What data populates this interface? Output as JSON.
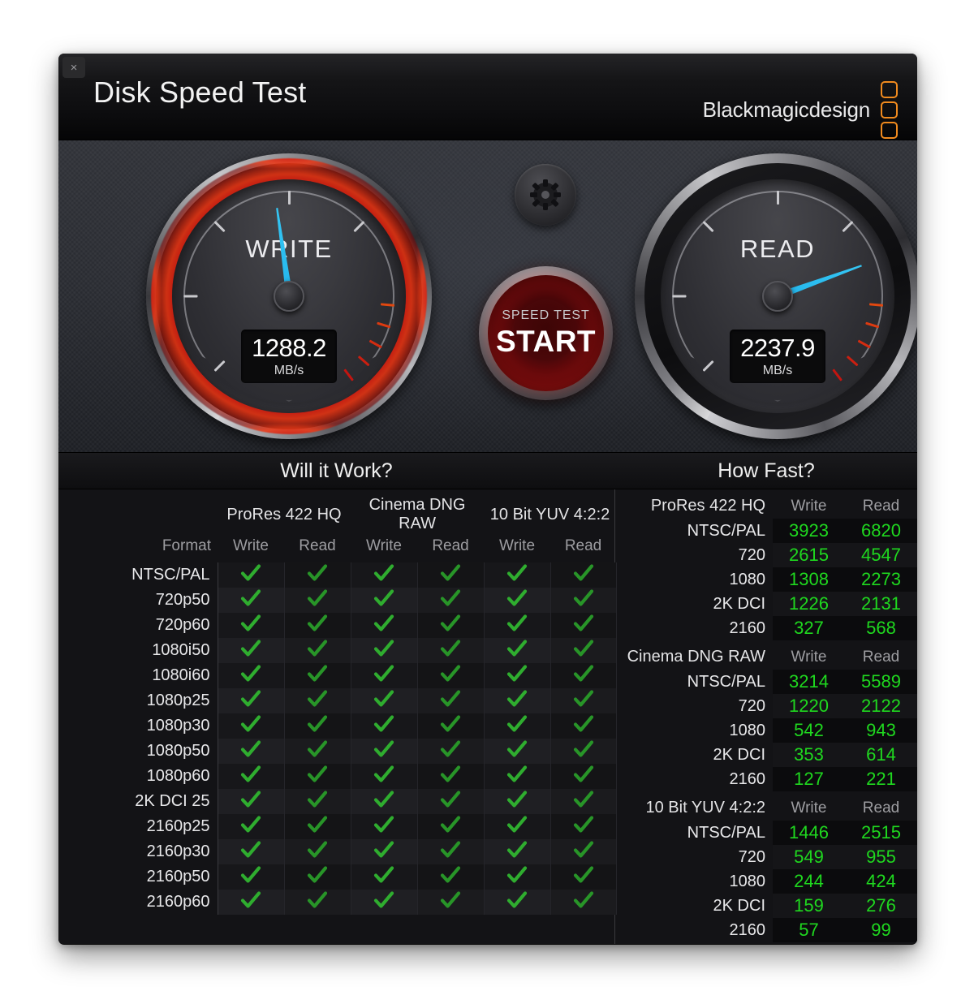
{
  "window": {
    "title": "Disk Speed Test",
    "close_label": "×",
    "brand": "Blackmagicdesign"
  },
  "gauges": {
    "write": {
      "label": "WRITE",
      "value": "1288.2",
      "unit": "MB/s",
      "needle_deg": -8
    },
    "read": {
      "label": "READ",
      "value": "2237.9",
      "unit": "MB/s",
      "needle_deg": 70
    }
  },
  "controls": {
    "gear_icon": "gear-icon",
    "start_sub": "SPEED TEST",
    "start_main": "START"
  },
  "sections": {
    "left_title": "Will it Work?",
    "right_title": "How Fast?"
  },
  "will_it_work": {
    "format_header": "Format",
    "groups": [
      "ProRes 422 HQ",
      "Cinema DNG RAW",
      "10 Bit YUV 4:2:2"
    ],
    "sub_headers": [
      "Write",
      "Read"
    ],
    "rows": [
      {
        "format": "NTSC/PAL",
        "cells": [
          "yes",
          "yes",
          "yes",
          "yes",
          "yes",
          "yes"
        ]
      },
      {
        "format": "720p50",
        "cells": [
          "yes",
          "yes",
          "yes",
          "yes",
          "yes",
          "yes"
        ]
      },
      {
        "format": "720p60",
        "cells": [
          "yes",
          "yes",
          "yes",
          "yes",
          "yes",
          "yes"
        ]
      },
      {
        "format": "1080i50",
        "cells": [
          "yes",
          "yes",
          "yes",
          "yes",
          "yes",
          "yes"
        ]
      },
      {
        "format": "1080i60",
        "cells": [
          "yes",
          "yes",
          "yes",
          "yes",
          "yes",
          "yes"
        ]
      },
      {
        "format": "1080p25",
        "cells": [
          "yes",
          "yes",
          "yes",
          "yes",
          "yes",
          "yes"
        ]
      },
      {
        "format": "1080p30",
        "cells": [
          "yes",
          "yes",
          "yes",
          "yes",
          "yes",
          "yes"
        ]
      },
      {
        "format": "1080p50",
        "cells": [
          "yes",
          "yes",
          "yes",
          "yes",
          "yes",
          "yes"
        ]
      },
      {
        "format": "1080p60",
        "cells": [
          "yes",
          "yes",
          "yes",
          "yes",
          "yes",
          "yes"
        ]
      },
      {
        "format": "2K DCI 25",
        "cells": [
          "yes",
          "yes",
          "yes",
          "yes",
          "yes",
          "yes"
        ]
      },
      {
        "format": "2160p25",
        "cells": [
          "yes",
          "yes",
          "yes",
          "yes",
          "yes",
          "yes"
        ]
      },
      {
        "format": "2160p30",
        "cells": [
          "yes",
          "yes",
          "yes",
          "yes",
          "yes",
          "yes"
        ]
      },
      {
        "format": "2160p50",
        "cells": [
          "yes",
          "yes",
          "yes",
          "yes",
          "yes",
          "yes"
        ]
      },
      {
        "format": "2160p60",
        "cells": [
          "yes",
          "yes",
          "yes",
          "yes",
          "yes",
          "yes"
        ]
      }
    ]
  },
  "how_fast": {
    "column_headers": [
      "Write",
      "Read"
    ],
    "groups": [
      {
        "name": "ProRes 422 HQ",
        "rows": [
          {
            "label": "NTSC/PAL",
            "write": "3923",
            "read": "6820"
          },
          {
            "label": "720",
            "write": "2615",
            "read": "4547"
          },
          {
            "label": "1080",
            "write": "1308",
            "read": "2273"
          },
          {
            "label": "2K DCI",
            "write": "1226",
            "read": "2131"
          },
          {
            "label": "2160",
            "write": "327",
            "read": "568"
          }
        ]
      },
      {
        "name": "Cinema DNG RAW",
        "rows": [
          {
            "label": "NTSC/PAL",
            "write": "3214",
            "read": "5589"
          },
          {
            "label": "720",
            "write": "1220",
            "read": "2122"
          },
          {
            "label": "1080",
            "write": "542",
            "read": "943"
          },
          {
            "label": "2K DCI",
            "write": "353",
            "read": "614"
          },
          {
            "label": "2160",
            "write": "127",
            "read": "221"
          }
        ]
      },
      {
        "name": "10 Bit YUV 4:2:2",
        "rows": [
          {
            "label": "NTSC/PAL",
            "write": "1446",
            "read": "2515"
          },
          {
            "label": "720",
            "write": "549",
            "read": "955"
          },
          {
            "label": "1080",
            "write": "244",
            "read": "424"
          },
          {
            "label": "2K DCI",
            "write": "159",
            "read": "276"
          },
          {
            "label": "2160",
            "write": "57",
            "read": "99"
          }
        ]
      }
    ]
  },
  "colors": {
    "brand_orange": "#f08a1e",
    "needle_blue": "#28baee",
    "value_green": "#1fd81f",
    "check_green": "#2fad2f",
    "start_red": "#c21514"
  }
}
